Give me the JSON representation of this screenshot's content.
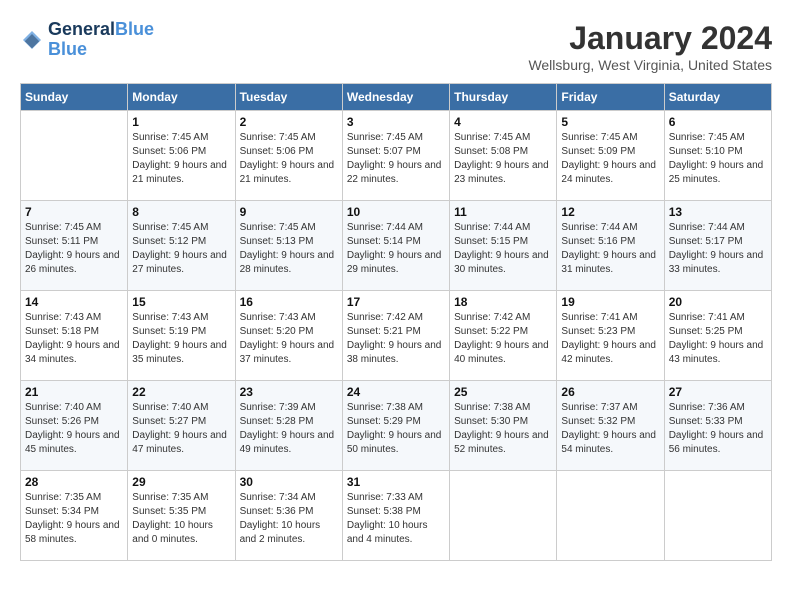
{
  "header": {
    "logo_line1": "General",
    "logo_line2": "Blue",
    "month_title": "January 2024",
    "location": "Wellsburg, West Virginia, United States"
  },
  "days_of_week": [
    "Sunday",
    "Monday",
    "Tuesday",
    "Wednesday",
    "Thursday",
    "Friday",
    "Saturday"
  ],
  "weeks": [
    [
      {
        "day": "",
        "sunrise": "",
        "sunset": "",
        "daylight": ""
      },
      {
        "day": "1",
        "sunrise": "Sunrise: 7:45 AM",
        "sunset": "Sunset: 5:06 PM",
        "daylight": "Daylight: 9 hours and 21 minutes."
      },
      {
        "day": "2",
        "sunrise": "Sunrise: 7:45 AM",
        "sunset": "Sunset: 5:06 PM",
        "daylight": "Daylight: 9 hours and 21 minutes."
      },
      {
        "day": "3",
        "sunrise": "Sunrise: 7:45 AM",
        "sunset": "Sunset: 5:07 PM",
        "daylight": "Daylight: 9 hours and 22 minutes."
      },
      {
        "day": "4",
        "sunrise": "Sunrise: 7:45 AM",
        "sunset": "Sunset: 5:08 PM",
        "daylight": "Daylight: 9 hours and 23 minutes."
      },
      {
        "day": "5",
        "sunrise": "Sunrise: 7:45 AM",
        "sunset": "Sunset: 5:09 PM",
        "daylight": "Daylight: 9 hours and 24 minutes."
      },
      {
        "day": "6",
        "sunrise": "Sunrise: 7:45 AM",
        "sunset": "Sunset: 5:10 PM",
        "daylight": "Daylight: 9 hours and 25 minutes."
      }
    ],
    [
      {
        "day": "7",
        "sunrise": "Sunrise: 7:45 AM",
        "sunset": "Sunset: 5:11 PM",
        "daylight": "Daylight: 9 hours and 26 minutes."
      },
      {
        "day": "8",
        "sunrise": "Sunrise: 7:45 AM",
        "sunset": "Sunset: 5:12 PM",
        "daylight": "Daylight: 9 hours and 27 minutes."
      },
      {
        "day": "9",
        "sunrise": "Sunrise: 7:45 AM",
        "sunset": "Sunset: 5:13 PM",
        "daylight": "Daylight: 9 hours and 28 minutes."
      },
      {
        "day": "10",
        "sunrise": "Sunrise: 7:44 AM",
        "sunset": "Sunset: 5:14 PM",
        "daylight": "Daylight: 9 hours and 29 minutes."
      },
      {
        "day": "11",
        "sunrise": "Sunrise: 7:44 AM",
        "sunset": "Sunset: 5:15 PM",
        "daylight": "Daylight: 9 hours and 30 minutes."
      },
      {
        "day": "12",
        "sunrise": "Sunrise: 7:44 AM",
        "sunset": "Sunset: 5:16 PM",
        "daylight": "Daylight: 9 hours and 31 minutes."
      },
      {
        "day": "13",
        "sunrise": "Sunrise: 7:44 AM",
        "sunset": "Sunset: 5:17 PM",
        "daylight": "Daylight: 9 hours and 33 minutes."
      }
    ],
    [
      {
        "day": "14",
        "sunrise": "Sunrise: 7:43 AM",
        "sunset": "Sunset: 5:18 PM",
        "daylight": "Daylight: 9 hours and 34 minutes."
      },
      {
        "day": "15",
        "sunrise": "Sunrise: 7:43 AM",
        "sunset": "Sunset: 5:19 PM",
        "daylight": "Daylight: 9 hours and 35 minutes."
      },
      {
        "day": "16",
        "sunrise": "Sunrise: 7:43 AM",
        "sunset": "Sunset: 5:20 PM",
        "daylight": "Daylight: 9 hours and 37 minutes."
      },
      {
        "day": "17",
        "sunrise": "Sunrise: 7:42 AM",
        "sunset": "Sunset: 5:21 PM",
        "daylight": "Daylight: 9 hours and 38 minutes."
      },
      {
        "day": "18",
        "sunrise": "Sunrise: 7:42 AM",
        "sunset": "Sunset: 5:22 PM",
        "daylight": "Daylight: 9 hours and 40 minutes."
      },
      {
        "day": "19",
        "sunrise": "Sunrise: 7:41 AM",
        "sunset": "Sunset: 5:23 PM",
        "daylight": "Daylight: 9 hours and 42 minutes."
      },
      {
        "day": "20",
        "sunrise": "Sunrise: 7:41 AM",
        "sunset": "Sunset: 5:25 PM",
        "daylight": "Daylight: 9 hours and 43 minutes."
      }
    ],
    [
      {
        "day": "21",
        "sunrise": "Sunrise: 7:40 AM",
        "sunset": "Sunset: 5:26 PM",
        "daylight": "Daylight: 9 hours and 45 minutes."
      },
      {
        "day": "22",
        "sunrise": "Sunrise: 7:40 AM",
        "sunset": "Sunset: 5:27 PM",
        "daylight": "Daylight: 9 hours and 47 minutes."
      },
      {
        "day": "23",
        "sunrise": "Sunrise: 7:39 AM",
        "sunset": "Sunset: 5:28 PM",
        "daylight": "Daylight: 9 hours and 49 minutes."
      },
      {
        "day": "24",
        "sunrise": "Sunrise: 7:38 AM",
        "sunset": "Sunset: 5:29 PM",
        "daylight": "Daylight: 9 hours and 50 minutes."
      },
      {
        "day": "25",
        "sunrise": "Sunrise: 7:38 AM",
        "sunset": "Sunset: 5:30 PM",
        "daylight": "Daylight: 9 hours and 52 minutes."
      },
      {
        "day": "26",
        "sunrise": "Sunrise: 7:37 AM",
        "sunset": "Sunset: 5:32 PM",
        "daylight": "Daylight: 9 hours and 54 minutes."
      },
      {
        "day": "27",
        "sunrise": "Sunrise: 7:36 AM",
        "sunset": "Sunset: 5:33 PM",
        "daylight": "Daylight: 9 hours and 56 minutes."
      }
    ],
    [
      {
        "day": "28",
        "sunrise": "Sunrise: 7:35 AM",
        "sunset": "Sunset: 5:34 PM",
        "daylight": "Daylight: 9 hours and 58 minutes."
      },
      {
        "day": "29",
        "sunrise": "Sunrise: 7:35 AM",
        "sunset": "Sunset: 5:35 PM",
        "daylight": "Daylight: 10 hours and 0 minutes."
      },
      {
        "day": "30",
        "sunrise": "Sunrise: 7:34 AM",
        "sunset": "Sunset: 5:36 PM",
        "daylight": "Daylight: 10 hours and 2 minutes."
      },
      {
        "day": "31",
        "sunrise": "Sunrise: 7:33 AM",
        "sunset": "Sunset: 5:38 PM",
        "daylight": "Daylight: 10 hours and 4 minutes."
      },
      {
        "day": "",
        "sunrise": "",
        "sunset": "",
        "daylight": ""
      },
      {
        "day": "",
        "sunrise": "",
        "sunset": "",
        "daylight": ""
      },
      {
        "day": "",
        "sunrise": "",
        "sunset": "",
        "daylight": ""
      }
    ]
  ]
}
